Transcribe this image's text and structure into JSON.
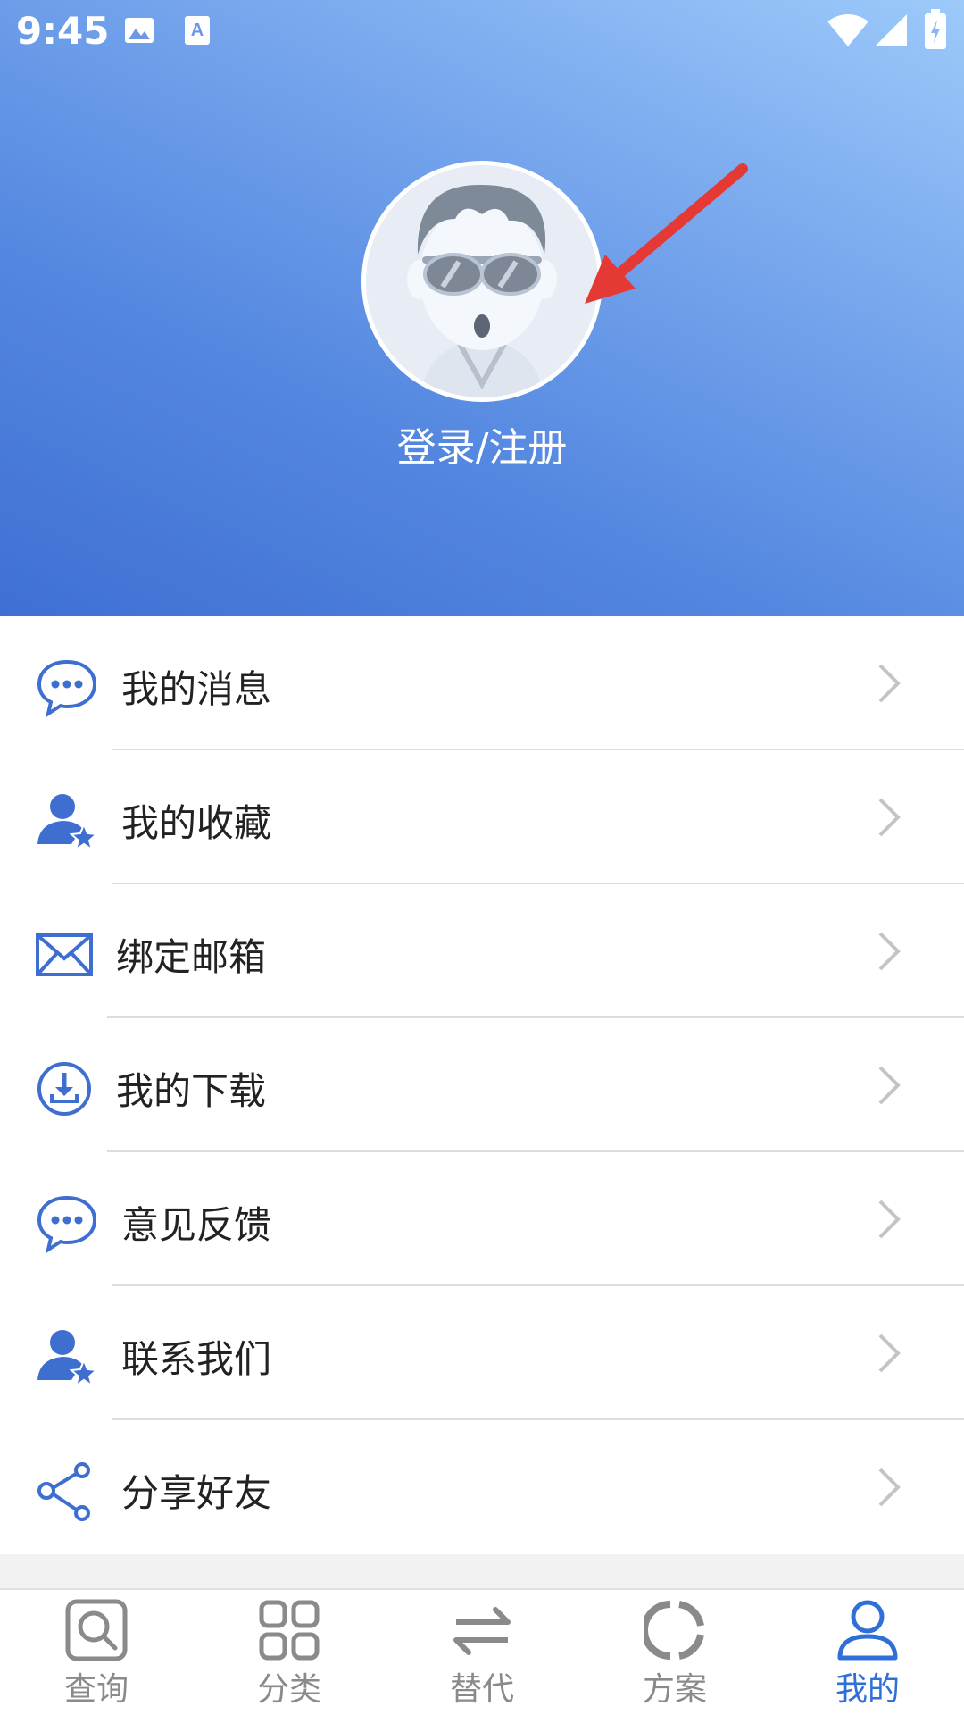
{
  "status_bar": {
    "time": "9:45"
  },
  "profile": {
    "login_label": "登录/注册"
  },
  "menu": [
    {
      "label": "我的消息",
      "icon": "chat-bubble-icon"
    },
    {
      "label": "我的收藏",
      "icon": "user-star-icon"
    },
    {
      "label": "绑定邮箱",
      "icon": "envelope-icon"
    },
    {
      "label": "我的下载",
      "icon": "download-icon"
    },
    {
      "label": "意见反馈",
      "icon": "chat-bubble-icon"
    },
    {
      "label": "联系我们",
      "icon": "user-star-icon"
    },
    {
      "label": "分享好友",
      "icon": "share-icon"
    }
  ],
  "tabs": [
    {
      "label": "查询",
      "icon": "search-icon",
      "active": false
    },
    {
      "label": "分类",
      "icon": "grid-icon",
      "active": false
    },
    {
      "label": "替代",
      "icon": "swap-arrows-icon",
      "active": false
    },
    {
      "label": "方案",
      "icon": "ring-icon",
      "active": false
    },
    {
      "label": "我的",
      "icon": "person-icon",
      "active": true
    }
  ],
  "colors": {
    "accent": "#2f6fd8",
    "header_top": "#9ccafa",
    "header_bottom": "#3f6fd4",
    "arrow": "#e53935"
  }
}
